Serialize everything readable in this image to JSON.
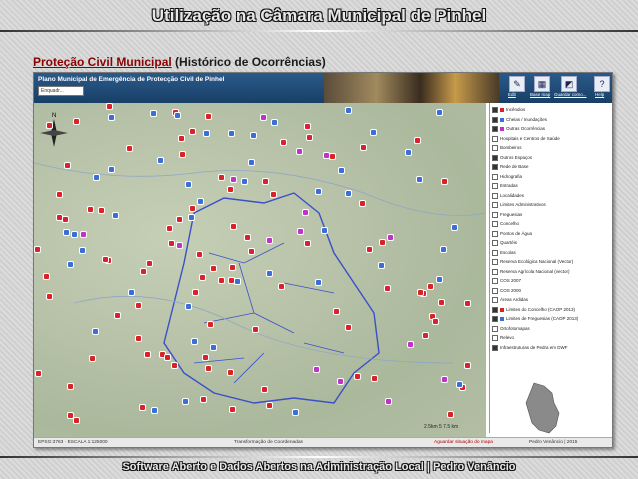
{
  "slide": {
    "title": "Utilização na Câmara Municipal de Pinhel",
    "subtitle_link": "Proteção Civil Municipal",
    "subtitle_rest": " (Histórico de Ocorrências)",
    "footer": "Software Aberto e Dados Abertos na Administração Local   |   Pedro Venâncio"
  },
  "app": {
    "title": "Plano Municipal de Emergência de Protecção Civil de Pinhel",
    "combo": "Enquadr...",
    "tools": [
      {
        "icon": "edit-icon",
        "label": "Edit"
      },
      {
        "icon": "map-layers-icon",
        "label": "Base map"
      },
      {
        "icon": "select-icon",
        "label": "Guardar como..."
      },
      {
        "icon": "help-icon",
        "label": "Help"
      }
    ],
    "status": {
      "left": "EPSG:3763 · ESCALA 1:125000",
      "center": "Transformação de Coordenadas",
      "right_warning": "Aguardar situação do mapa",
      "credit": "Pedro Venâncio | 2015"
    },
    "scale_label": "2.5km  5  7.5 km",
    "colors": {
      "red": "#d8232a",
      "blue": "#3a6fd8",
      "magenta": "#c032c8",
      "yellow": "#f0d020"
    }
  },
  "layers": [
    {
      "label": "Incêndios",
      "checked": true,
      "symbol": "#d8232a"
    },
    {
      "label": "Cheias / Inundações",
      "checked": true,
      "symbol": "#3a6fd8"
    },
    {
      "label": "Outras Ocorrências",
      "checked": true,
      "symbol": "#c032c8"
    },
    {
      "label": "Hospitais e Centros de Saúde",
      "checked": false,
      "symbol": ""
    },
    {
      "label": "Bombeiros",
      "checked": false,
      "symbol": ""
    },
    {
      "label": "Outros Espaços",
      "checked": true,
      "symbol": ""
    },
    {
      "label": "Rede de Base",
      "checked": true,
      "symbol": ""
    },
    {
      "label": "Hidrografia",
      "checked": false,
      "symbol": ""
    },
    {
      "label": "Estradas",
      "checked": false,
      "symbol": ""
    },
    {
      "label": "Localidades",
      "checked": false,
      "symbol": ""
    },
    {
      "label": "Limites Administrativos",
      "checked": false,
      "symbol": ""
    },
    {
      "label": "Freguesias",
      "checked": false,
      "symbol": ""
    },
    {
      "label": "Concelho",
      "checked": false,
      "symbol": ""
    },
    {
      "label": "Pontos de Água",
      "checked": false,
      "symbol": ""
    },
    {
      "label": "Quartéis",
      "checked": false,
      "symbol": ""
    },
    {
      "label": "Escolas",
      "checked": false,
      "symbol": ""
    },
    {
      "label": "Reserva Ecológica Nacional (Vector)",
      "checked": false,
      "symbol": ""
    },
    {
      "label": "Reserva Agrícola Nacional (vector)",
      "checked": false,
      "symbol": ""
    },
    {
      "label": "COS 2007",
      "checked": false,
      "symbol": ""
    },
    {
      "label": "COS 2000",
      "checked": false,
      "symbol": ""
    },
    {
      "label": "Áreas Ardidas",
      "checked": false,
      "symbol": ""
    },
    {
      "label": "Limites do Concelho (CAOP 2013)",
      "checked": true,
      "symbol": "#d8232a"
    },
    {
      "label": "Limites de Freguesias (CAOP 2013)",
      "checked": true,
      "symbol": "#3a6fd8"
    },
    {
      "label": "Ortofotomapas",
      "checked": false,
      "symbol": ""
    },
    {
      "label": "Relevo",
      "checked": false,
      "symbol": ""
    },
    {
      "label": "Infraestruturas de Pedra em DWF",
      "checked": true,
      "symbol": ""
    }
  ]
}
